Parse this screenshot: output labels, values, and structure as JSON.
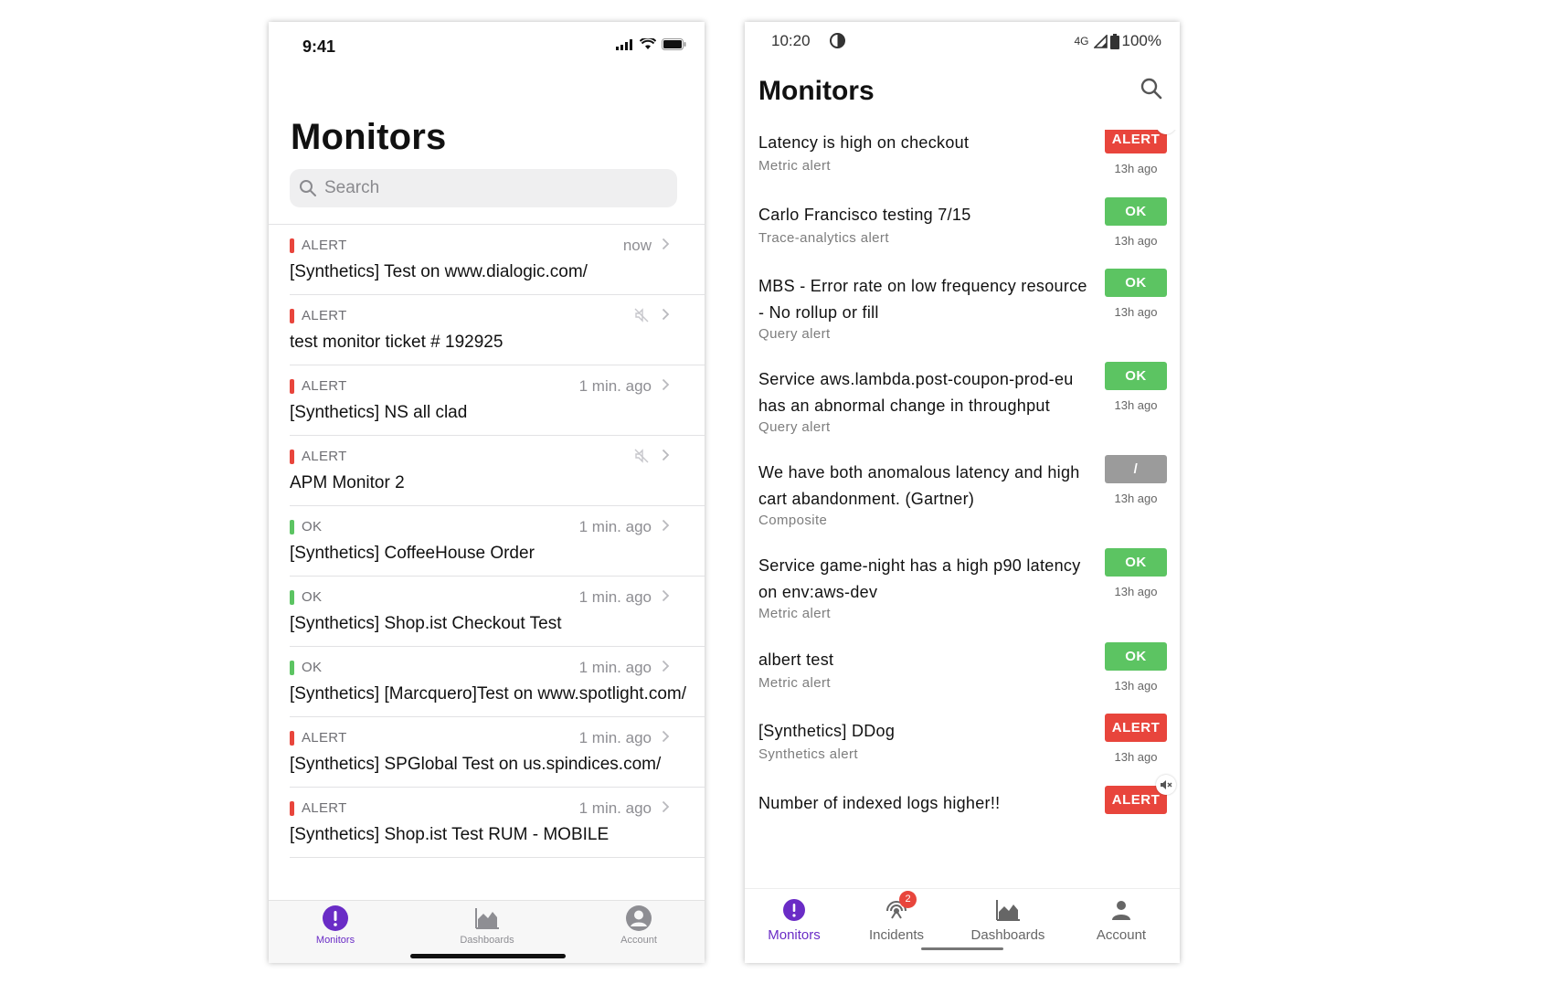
{
  "ios": {
    "status": {
      "time": "9:41"
    },
    "title": "Monitors",
    "search_placeholder": "Search",
    "monitors": [
      {
        "status": "ALERT",
        "name": "[Synthetics] Test on www.dialogic.com/",
        "time": "now",
        "muted": false
      },
      {
        "status": "ALERT",
        "name": "test monitor ticket # 192925",
        "time": "",
        "muted": true
      },
      {
        "status": "ALERT",
        "name": "[Synthetics] NS all clad",
        "time": "1 min. ago",
        "muted": false
      },
      {
        "status": "ALERT",
        "name": "APM Monitor 2",
        "time": "",
        "muted": true
      },
      {
        "status": "OK",
        "name": "[Synthetics] CoffeeHouse Order",
        "time": "1 min. ago",
        "muted": false
      },
      {
        "status": "OK",
        "name": "[Synthetics] Shop.ist Checkout Test",
        "time": "1 min. ago",
        "muted": false
      },
      {
        "status": "OK",
        "name": "[Synthetics] [Marcquero]Test on www.spotlight.com/",
        "time": "1 min. ago",
        "muted": false
      },
      {
        "status": "ALERT",
        "name": "[Synthetics] SPGlobal Test on us.spindices.com/",
        "time": "1 min. ago",
        "muted": false
      },
      {
        "status": "ALERT",
        "name": "[Synthetics] Shop.ist Test RUM - MOBILE",
        "time": "1 min. ago",
        "muted": false
      }
    ],
    "tabs": [
      {
        "label": "Monitors",
        "icon": "alert-circle-icon",
        "active": true
      },
      {
        "label": "Dashboards",
        "icon": "area-chart-icon",
        "active": false
      },
      {
        "label": "Account",
        "icon": "account-icon",
        "active": false
      }
    ]
  },
  "android": {
    "status": {
      "time": "10:20",
      "network": "4G",
      "battery": "100%"
    },
    "title": "Monitors",
    "monitors": [
      {
        "name": "Latency is high on checkout",
        "type": "Metric alert",
        "status": "ALERT",
        "ago": "13h ago",
        "muted": true
      },
      {
        "name": "Carlo Francisco testing 7/15",
        "type": "Trace-analytics alert",
        "status": "OK",
        "ago": "13h ago",
        "muted": false
      },
      {
        "name": "MBS - Error rate on low frequency resource - No rollup or fill",
        "type": "Query alert",
        "status": "OK",
        "ago": "13h ago",
        "muted": false
      },
      {
        "name": "Service aws.lambda.post-coupon-prod-eu has an abnormal change in throughput",
        "type": "Query alert",
        "status": "OK",
        "ago": "13h ago",
        "muted": false
      },
      {
        "name": "We have both anomalous latency and high cart abandonment. (Gartner)",
        "type": "Composite",
        "status": "/",
        "ago": "13h ago",
        "muted": false
      },
      {
        "name": "Service game-night has a high p90 latency on env:aws-dev",
        "type": "Metric alert",
        "status": "OK",
        "ago": "13h ago",
        "muted": false
      },
      {
        "name": "albert test",
        "type": "Metric alert",
        "status": "OK",
        "ago": "13h ago",
        "muted": false
      },
      {
        "name": "[Synthetics] DDog",
        "type": "Synthetics alert",
        "status": "ALERT",
        "ago": "13h ago",
        "muted": false
      },
      {
        "name": "Number of indexed logs higher!!",
        "type": "",
        "status": "ALERT",
        "ago": "",
        "muted": true
      }
    ],
    "nav": [
      {
        "label": "Monitors",
        "icon": "alert-circle-icon",
        "active": true,
        "badge": ""
      },
      {
        "label": "Incidents",
        "icon": "incidents-icon",
        "active": false,
        "badge": "2"
      },
      {
        "label": "Dashboards",
        "icon": "area-chart-icon",
        "active": false,
        "badge": ""
      },
      {
        "label": "Account",
        "icon": "person-icon",
        "active": false,
        "badge": ""
      }
    ]
  },
  "colors": {
    "alert": "#e8453c",
    "ok": "#5cc462",
    "unknown": "#9b9b9b",
    "accent": "#6a2cc6"
  }
}
